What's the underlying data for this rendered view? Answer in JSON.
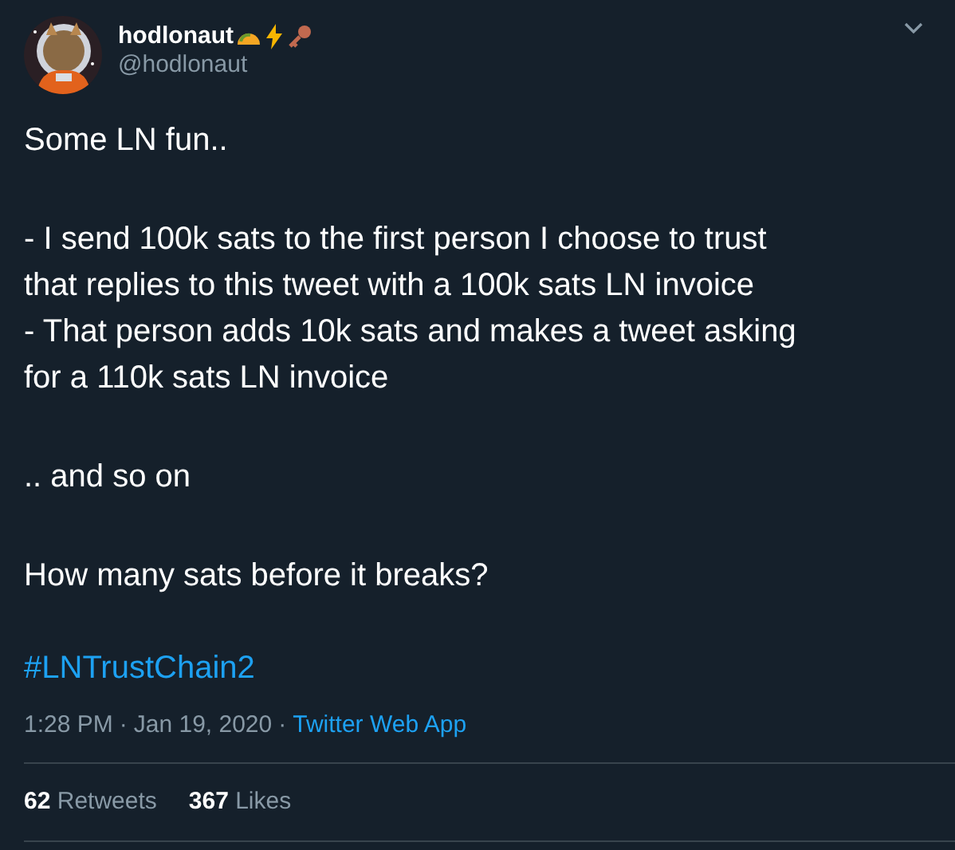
{
  "author": {
    "name": "hodlonaut",
    "handle": "@hodlonaut"
  },
  "paragraphs": [
    [
      "Some LN fun.."
    ],
    [
      "- I send 100k sats to the first person I choose to trust",
      "that replies to this tweet with a 100k sats LN invoice",
      "- That person adds 10k sats and makes a tweet asking",
      "for a 110k sats LN invoice"
    ],
    [
      ".. and so on"
    ],
    [
      "How many sats before it breaks?"
    ]
  ],
  "hashtag": "#LNTrustChain2",
  "meta": [
    {
      "kind": "time",
      "text": "1:28 PM"
    },
    {
      "kind": "separator",
      "text": "·"
    },
    {
      "kind": "date",
      "text": "Jan 19, 2020"
    },
    {
      "kind": "separator",
      "text": "·"
    },
    {
      "kind": "source",
      "text": "Twitter Web App"
    }
  ],
  "stats": [
    {
      "count": "62",
      "label": "Retweets"
    },
    {
      "count": "367",
      "label": "Likes"
    }
  ]
}
